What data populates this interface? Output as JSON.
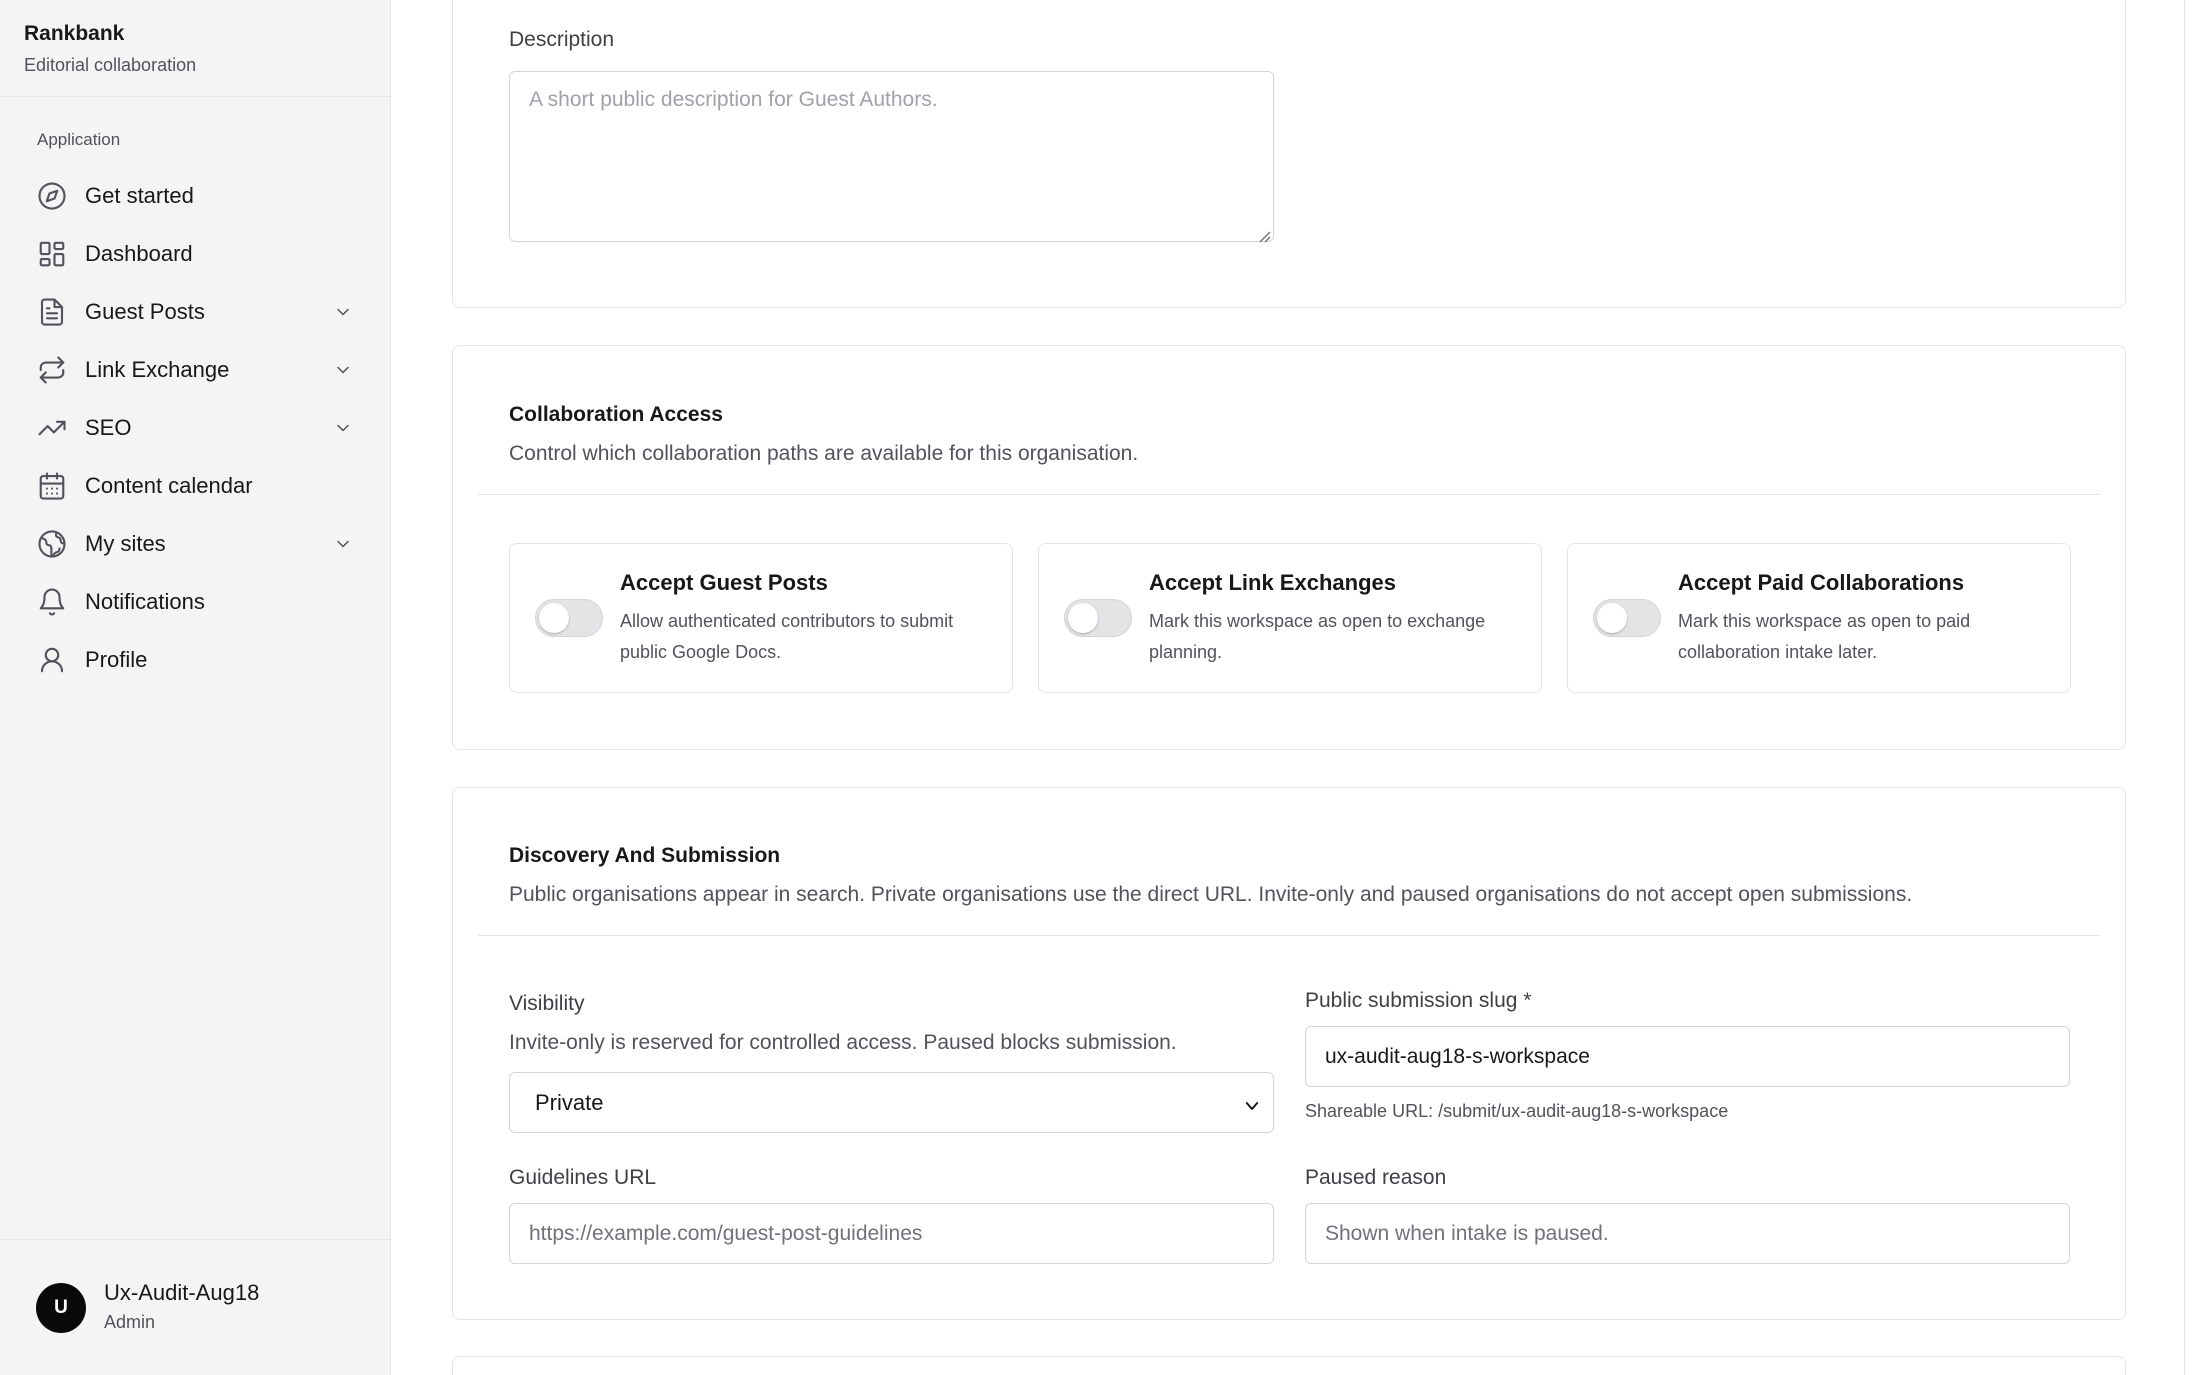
{
  "brand": {
    "name": "Rankbank",
    "subtitle": "Editorial collaboration"
  },
  "sidebar": {
    "group_label": "Application",
    "items": [
      {
        "label": "Get started",
        "icon": "compass-icon",
        "expandable": false
      },
      {
        "label": "Dashboard",
        "icon": "dashboard-grid-icon",
        "expandable": false
      },
      {
        "label": "Guest Posts",
        "icon": "document-icon",
        "expandable": true
      },
      {
        "label": "Link Exchange",
        "icon": "repeat-arrows-icon",
        "expandable": true
      },
      {
        "label": "SEO",
        "icon": "trending-up-icon",
        "expandable": true
      },
      {
        "label": "Content calendar",
        "icon": "calendar-icon",
        "expandable": false
      },
      {
        "label": "My sites",
        "icon": "globe-icon",
        "expandable": true
      },
      {
        "label": "Notifications",
        "icon": "bell-icon",
        "expandable": false
      },
      {
        "label": "Profile",
        "icon": "user-icon",
        "expandable": false
      }
    ]
  },
  "user": {
    "initial": "U",
    "name": "Ux-Audit-Aug18",
    "role": "Admin"
  },
  "description_section": {
    "label": "Description",
    "placeholder": "A short public description for Guest Authors."
  },
  "collaboration_access": {
    "title": "Collaboration Access",
    "description": "Control which collaboration paths are available for this organisation.",
    "toggles": [
      {
        "title": "Accept Guest Posts",
        "description": "Allow authenticated contributors to submit public Google Docs.",
        "enabled": false
      },
      {
        "title": "Accept Link Exchanges",
        "description": "Mark this workspace as open to exchange planning.",
        "enabled": false
      },
      {
        "title": "Accept Paid Collaborations",
        "description": "Mark this workspace as open to paid collaboration intake later.",
        "enabled": false
      }
    ]
  },
  "discovery": {
    "title": "Discovery And Submission",
    "description": "Public organisations appear in search. Private organisations use the direct URL. Invite-only and paused organisations do not accept open submissions.",
    "visibility": {
      "label": "Visibility",
      "help": "Invite-only is reserved for controlled access. Paused blocks submission.",
      "selected": "Private"
    },
    "slug": {
      "label": "Public submission slug *",
      "value": "ux-audit-aug18-s-workspace",
      "hint": "Shareable URL: /submit/ux-audit-aug18-s-workspace"
    },
    "guidelines": {
      "label": "Guidelines URL",
      "placeholder": "https://example.com/guest-post-guidelines"
    },
    "paused_reason": {
      "label": "Paused reason",
      "placeholder": "Shown when intake is paused."
    }
  },
  "colors": {
    "sidebar_bg": "#f4f4f5",
    "border": "#e4e4e7",
    "text_primary": "#18181b",
    "text_muted": "#52525b",
    "avatar_bg": "#0a0a0a"
  }
}
